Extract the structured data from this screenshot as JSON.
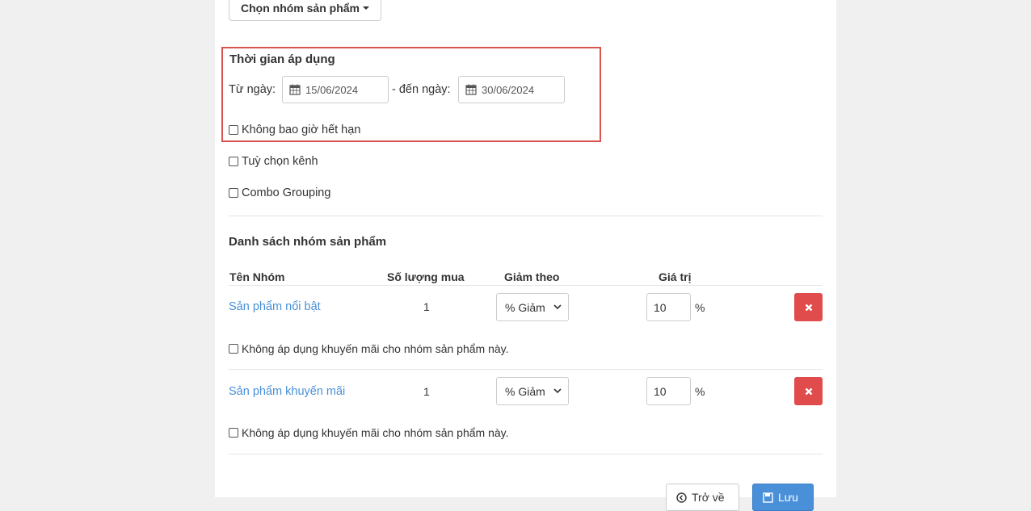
{
  "group_dropdown": {
    "label": "Chọn nhóm sản phẩm"
  },
  "apply_time": {
    "title": "Thời gian áp dụng",
    "from_label": "Từ ngày:",
    "from_value": "15/06/2024",
    "to_label": "- đến ngày:",
    "to_value": "30/06/2024",
    "never_expire_label": "Không bao giờ hết hạn"
  },
  "options": {
    "custom_channel_label": "Tuỳ chọn kênh",
    "combo_grouping_label": "Combo Grouping"
  },
  "product_groups": {
    "title": "Danh sách nhóm sản phẩm",
    "columns": [
      "Tên Nhóm",
      "Số lượng mua",
      "Giảm theo",
      "Giá trị"
    ],
    "rows": [
      {
        "name": "Sản phẩm nổi bật",
        "quantity": "1",
        "discount_type": "% Giảm",
        "value": "10",
        "unit": "%",
        "exclude_label": "Không áp dụng khuyến mãi cho nhóm sản phẩm này."
      },
      {
        "name": "Sản phẩm khuyến mãi",
        "quantity": "1",
        "discount_type": "% Giảm",
        "value": "10",
        "unit": "%",
        "exclude_label": "Không áp dụng khuyến mãi cho nhóm sản phẩm này."
      }
    ]
  },
  "footer": {
    "back_label": "Trở về",
    "save_label": "Lưu"
  },
  "colors": {
    "highlight": "#d9534f",
    "link": "#4a90d9",
    "danger": "#e04b4b",
    "primary": "#4a90d9"
  }
}
